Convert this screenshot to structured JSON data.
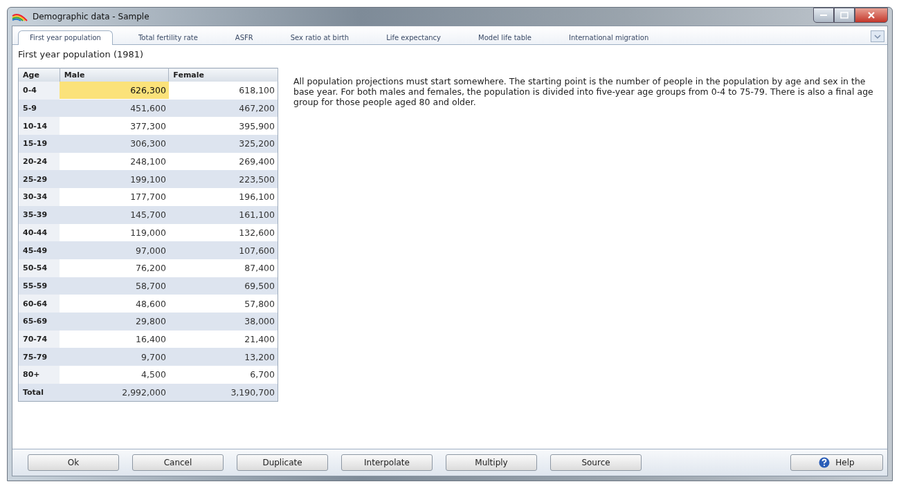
{
  "window": {
    "title": "Demographic data - Sample"
  },
  "tabs": [
    {
      "label": "First year population",
      "selected": true
    },
    {
      "label": "Total fertility rate",
      "selected": false
    },
    {
      "label": "ASFR",
      "selected": false
    },
    {
      "label": "Sex ratio at birth",
      "selected": false
    },
    {
      "label": "Life expectancy",
      "selected": false
    },
    {
      "label": "Model life table",
      "selected": false
    },
    {
      "label": "International migration",
      "selected": false
    }
  ],
  "heading": "First year population (1981)",
  "table": {
    "columns": [
      "Age",
      "Male",
      "Female"
    ],
    "rows": [
      {
        "age": "0-4",
        "male": "626,300",
        "female": "618,100",
        "male_selected": true
      },
      {
        "age": "5-9",
        "male": "451,600",
        "female": "467,200",
        "male_selected": false
      },
      {
        "age": "10-14",
        "male": "377,300",
        "female": "395,900",
        "male_selected": false
      },
      {
        "age": "15-19",
        "male": "306,300",
        "female": "325,200",
        "male_selected": false
      },
      {
        "age": "20-24",
        "male": "248,100",
        "female": "269,400",
        "male_selected": false
      },
      {
        "age": "25-29",
        "male": "199,100",
        "female": "223,500",
        "male_selected": false
      },
      {
        "age": "30-34",
        "male": "177,700",
        "female": "196,100",
        "male_selected": false
      },
      {
        "age": "35-39",
        "male": "145,700",
        "female": "161,100",
        "male_selected": false
      },
      {
        "age": "40-44",
        "male": "119,000",
        "female": "132,600",
        "male_selected": false
      },
      {
        "age": "45-49",
        "male": "97,000",
        "female": "107,600",
        "male_selected": false
      },
      {
        "age": "50-54",
        "male": "76,200",
        "female": "87,400",
        "male_selected": false
      },
      {
        "age": "55-59",
        "male": "58,700",
        "female": "69,500",
        "male_selected": false
      },
      {
        "age": "60-64",
        "male": "48,600",
        "female": "57,800",
        "male_selected": false
      },
      {
        "age": "65-69",
        "male": "29,800",
        "female": "38,000",
        "male_selected": false
      },
      {
        "age": "70-74",
        "male": "16,400",
        "female": "21,400",
        "male_selected": false
      },
      {
        "age": "75-79",
        "male": "9,700",
        "female": "13,200",
        "male_selected": false
      },
      {
        "age": "80+",
        "male": "4,500",
        "female": "6,700",
        "male_selected": false
      },
      {
        "age": "Total",
        "male": "2,992,000",
        "female": "3,190,700",
        "male_selected": false
      }
    ]
  },
  "description": "All population projections must start somewhere. The starting point is the number of people in the population by age and sex in the base year. For both males and females, the population is divided into five-year age groups from 0-4 to 75-79. There is also a final age group for those people aged 80 and older.",
  "buttons": [
    {
      "label": "Ok",
      "kind": "plain"
    },
    {
      "label": "Cancel",
      "kind": "plain"
    },
    {
      "label": "Duplicate",
      "kind": "plain"
    },
    {
      "label": "Interpolate",
      "kind": "plain"
    },
    {
      "label": "Multiply",
      "kind": "plain"
    },
    {
      "label": "Source",
      "kind": "plain"
    },
    {
      "label": "Help",
      "kind": "help"
    }
  ]
}
